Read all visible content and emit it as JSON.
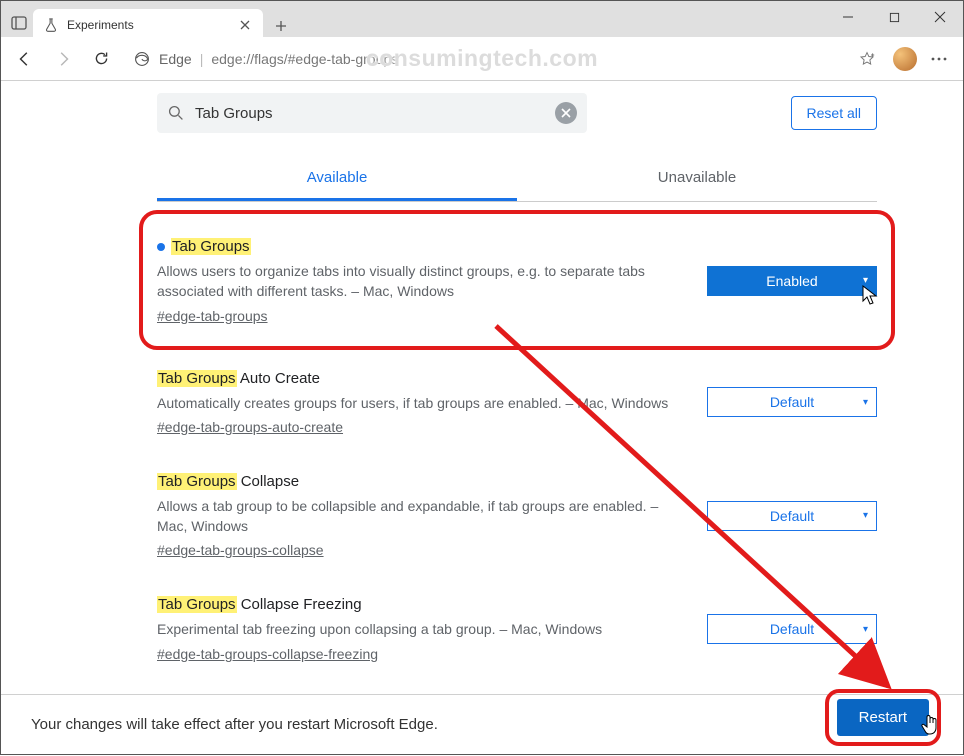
{
  "window": {
    "tab_title": "Experiments"
  },
  "watermark": "consumingtech.com",
  "toolbar": {
    "browser_label": "Edge",
    "url": "edge://flags/#edge-tab-groups"
  },
  "search": {
    "value": "Tab Groups",
    "reset_label": "Reset all"
  },
  "tabs": {
    "available": "Available",
    "unavailable": "Unavailable"
  },
  "flags": [
    {
      "highlight": "Tab Groups",
      "title_rest": "",
      "desc": "Allows users to organize tabs into visually distinct groups, e.g. to separate tabs associated with different tasks. – Mac, Windows",
      "hash": "#edge-tab-groups",
      "select": "Enabled",
      "select_style": "enabled",
      "dot": true
    },
    {
      "highlight": "Tab Groups",
      "title_rest": " Auto Create",
      "desc": "Automatically creates groups for users, if tab groups are enabled. – Mac, Windows",
      "hash": "#edge-tab-groups-auto-create",
      "select": "Default",
      "select_style": "",
      "dot": false
    },
    {
      "highlight": "Tab Groups",
      "title_rest": " Collapse",
      "desc": "Allows a tab group to be collapsible and expandable, if tab groups are enabled. – Mac, Windows",
      "hash": "#edge-tab-groups-collapse",
      "select": "Default",
      "select_style": "",
      "dot": false
    },
    {
      "highlight": "Tab Groups",
      "title_rest": " Collapse Freezing",
      "desc": "Experimental tab freezing upon collapsing a tab group. – Mac, Windows",
      "hash": "#edge-tab-groups-collapse-freezing",
      "select": "Default",
      "select_style": "",
      "dot": false
    }
  ],
  "footer": {
    "text": "Your changes will take effect after you restart Microsoft Edge.",
    "restart": "Restart"
  }
}
